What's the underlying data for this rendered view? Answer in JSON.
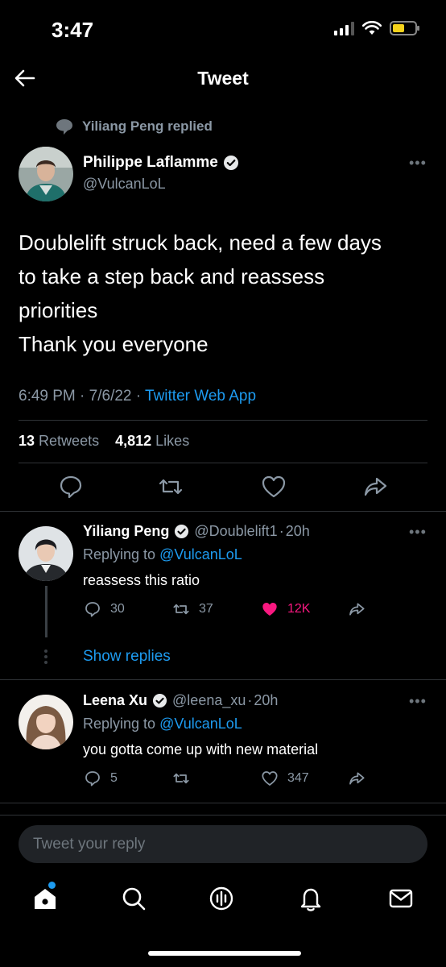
{
  "status_bar": {
    "time": "3:47"
  },
  "header": {
    "title": "Tweet"
  },
  "tweet": {
    "context": "Yiliang Peng replied",
    "author_name": "Philippe Laflamme",
    "author_handle": "@VulcanLoL",
    "text_lines": [
      "Doublelift struck back, need a few days",
      "to take a step back and reassess",
      "priorities",
      "Thank you everyone"
    ],
    "time": "6:49 PM",
    "date": "7/6/22",
    "source": "Twitter Web App",
    "retweets_count": "13",
    "retweets_label": "Retweets",
    "likes_count": "4,812",
    "likes_label": "Likes"
  },
  "replies": [
    {
      "name": "Yiliang Peng",
      "handle": "@Doublelift1",
      "age": "20h",
      "replying_prefix": "Replying to",
      "replying_to": "@VulcanLoL",
      "text": "reassess this ratio",
      "reply_count": "30",
      "retweet_count": "37",
      "like_count": "12K",
      "liked": true
    },
    {
      "name": "Leena Xu",
      "handle": "@leena_xu",
      "age": "20h",
      "replying_prefix": "Replying to",
      "replying_to": "@VulcanLoL",
      "text": "you gotta come up with new material",
      "reply_count": "5",
      "retweet_count": "",
      "like_count": "347",
      "liked": false
    }
  ],
  "show_replies_label": "Show replies",
  "composer": {
    "placeholder": "Tweet your reply"
  },
  "colors": {
    "accent": "#1d9bf0",
    "like": "#f91880",
    "muted": "#8b98a5",
    "battery": "#f5d21b"
  },
  "icons": [
    "back-arrow-icon",
    "speech-bubble-icon",
    "verified-badge-icon",
    "more-icon",
    "reply-icon",
    "retweet-icon",
    "like-icon",
    "share-icon",
    "home-icon",
    "search-icon",
    "spaces-icon",
    "notifications-icon",
    "messages-icon"
  ]
}
